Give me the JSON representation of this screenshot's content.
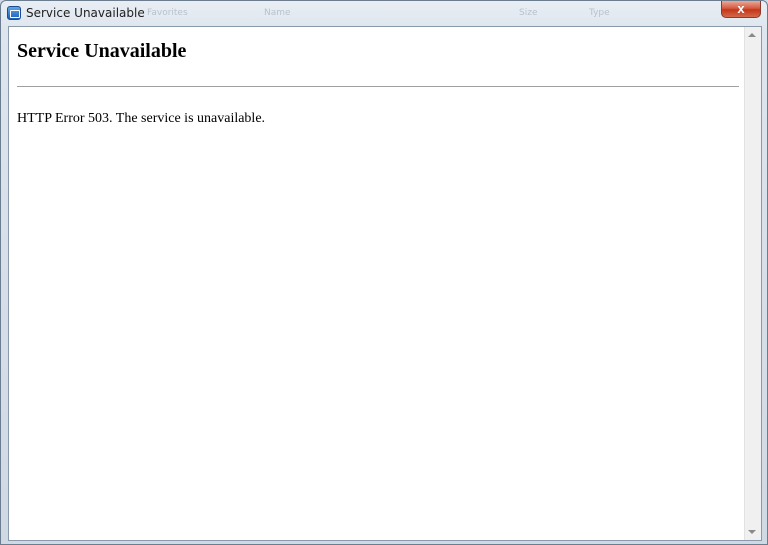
{
  "window": {
    "title": "Service Unavailable",
    "close_label": "x"
  },
  "background_ghosts": [
    "Favorites",
    "Name",
    "Size",
    "Type"
  ],
  "page": {
    "heading": "Service Unavailable",
    "message": "HTTP Error 503. The service is unavailable."
  },
  "icons": {
    "app": "browser-window-icon",
    "close": "close-icon",
    "scroll_up": "scroll-up-arrow-icon",
    "scroll_down": "scroll-down-arrow-icon"
  },
  "colors": {
    "close_button": "#c3361b",
    "window_frame": "#dde5ee",
    "content_background": "#ffffff"
  }
}
